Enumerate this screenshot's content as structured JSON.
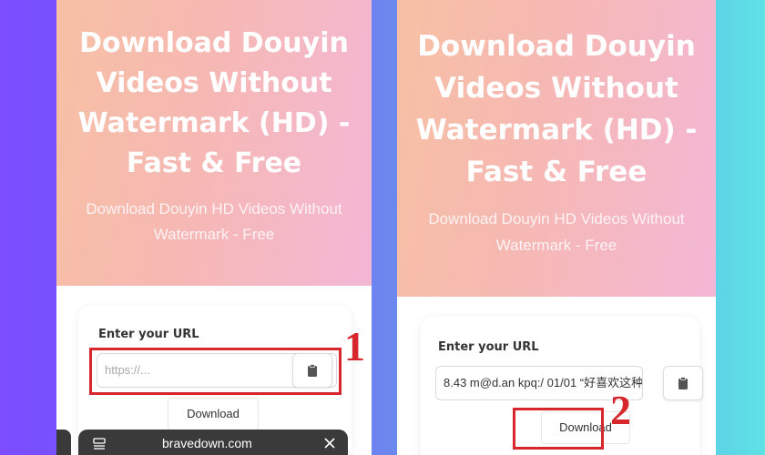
{
  "colors": {
    "accent_red": "#d8262d",
    "hero_start": "#f7c0a4",
    "hero_end": "#f3b7d6"
  },
  "left": {
    "hero_title": "Download Douyin Videos Without Watermark (HD) - Fast & Free",
    "hero_subtitle": "Download Douyin HD Videos Without Watermark - Free",
    "url_label": "Enter your URL",
    "url_placeholder": "https://...",
    "paste_icon": "clipboard-icon",
    "download_label": "Download",
    "step_number": "1"
  },
  "right": {
    "hero_title": "Download Douyin Videos Without Watermark (HD) - Fast & Free",
    "hero_subtitle": "Download Douyin HD Videos Without Watermark - Free",
    "url_label": "Enter your URL",
    "url_value": "8.43 m@d.an kpq:/ 01/01 “好喜欢这种",
    "paste_icon": "clipboard-icon",
    "download_label": "Download",
    "step_number": "2"
  },
  "browser": {
    "url": "bravedown.com",
    "tabs_icon": "tabs-icon",
    "close_icon": "close-icon"
  }
}
